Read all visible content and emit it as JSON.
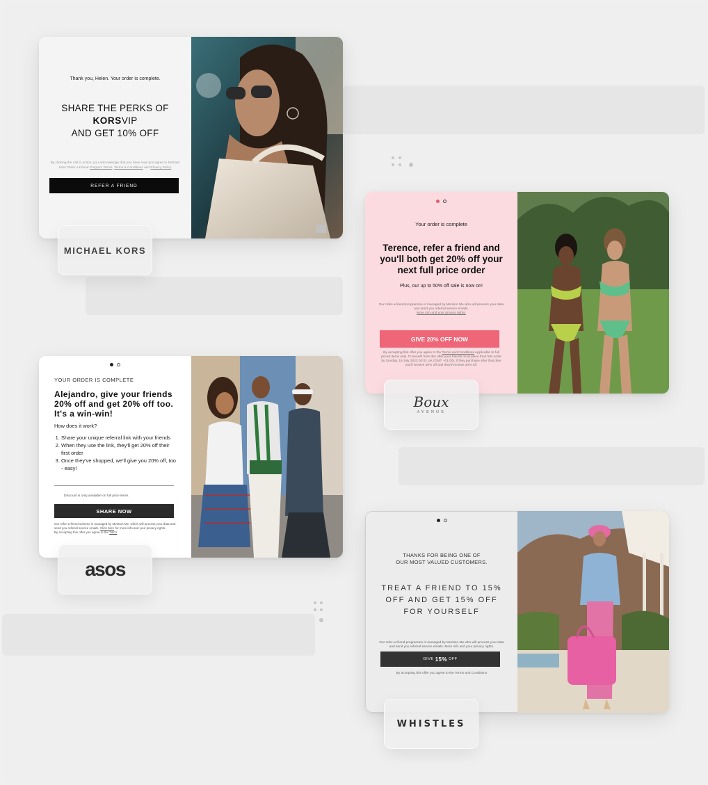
{
  "michael_kors": {
    "thanks": "Thank you, Helen. Your order is complete.",
    "headline_line1": "SHARE THE PERKS OF",
    "headline_brand_bold": "KORS",
    "headline_brand_rest": "VIP",
    "headline_line3": "AND GET 10% OFF",
    "legal_prefix": "By clicking the call to action, you acknowledge that you have read and agree to Michael Kors' Refer a Friend",
    "legal_link1": "Program Terms",
    "legal_link2": "Terms & Conditions",
    "legal_mid": "and",
    "legal_link3": "Privacy Policy",
    "cta": "REFER A FRIEND",
    "logo": "MICHAEL KORS"
  },
  "boux": {
    "sub": "Your order is complete",
    "headline": "Terence, refer a friend and you'll both get 20% off your next full price order",
    "sale": "Plus, our up to 50% off sale is now on!",
    "legal": "Our refer-a-friend programme is managed by Mention Me who will process your data and send you referral service emails.",
    "legal_link": "More info and your privacy rights.",
    "cta": "GIVE 20% OFF NOW",
    "terms_prefix": "By accepting this offer you agree to the",
    "terms_link": "Terms and Conditions",
    "terms_rest": "Applicable to full priced items only. To benefit from this offer your friends must place their first order by Sunday, 16 July 2023 00:01 UK (GMT +01:00), if they purchase after that date you'll receive 20% off and they'll receive 20% off.",
    "logo_script": "Boux",
    "logo_sub": "AVENUE"
  },
  "asos": {
    "sub": "YOUR ORDER IS COMPLETE",
    "headline": "Alejandro, give your friends 20% off and get 20% off too. It's a win-win!",
    "how": "How does it work?",
    "steps": [
      "Share your unique referral link with your friends",
      "When they use the link, they'll get 20% off their first order",
      "Once they've shopped, we'll give you 20% off, too - easy!"
    ],
    "disc": "Discount is only available on full price items",
    "cta": "SHARE NOW",
    "legal_prefix": "Our refer-a-friend scheme is managed by Mention Me, which will process your data and send you referral service emails.",
    "legal_link": "Click here",
    "legal_mid": "for more info and your privacy rights.",
    "legal_accept": "By accepting this offer you agree to the",
    "legal_tcs": "T&Cs",
    "logo": "asos"
  },
  "whistles": {
    "thanks_line1": "THANKS FOR BEING ONE OF",
    "thanks_line2": "OUR MOST VALUED CUSTOMERS.",
    "headline": "TREAT A FRIEND TO 15% OFF AND GET 15% OFF FOR YOURSELF",
    "legal": "Our refer-a-friend programme is managed by Mention Me who will process your data and send you referral service emails. More info and your privacy rights.",
    "cta_pre": "GIVE",
    "cta_bold": "15%",
    "cta_post": "OFF",
    "terms": "By accepting this offer you agree to the Terms and Conditions",
    "logo": "WHISTLES"
  },
  "colors": {
    "boux_pink": "#fbdbe0",
    "boux_cta": "#ee6677",
    "mk_cta": "#0b0b0b",
    "asos_cta": "#2b2b2b",
    "whistles_cta": "#333333"
  }
}
